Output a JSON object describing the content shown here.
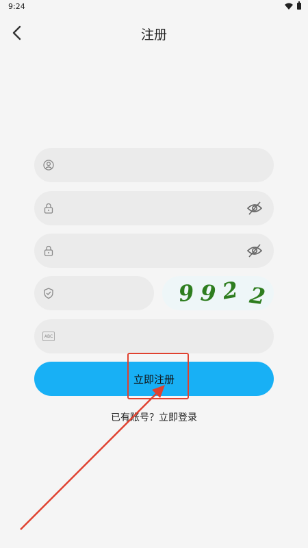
{
  "status_bar": {
    "time": "9:24"
  },
  "app_bar": {
    "title": "注册"
  },
  "form": {
    "username": {
      "value": "",
      "icon": "user-icon"
    },
    "password": {
      "value": "",
      "icon": "lock-icon"
    },
    "confirm_password": {
      "value": "",
      "icon": "lock-icon"
    },
    "captcha_input": {
      "value": "",
      "icon": "shield-check-icon"
    },
    "captcha_image": {
      "digits": [
        "9",
        "9",
        "2",
        "2"
      ],
      "color": "#2e7d1f"
    },
    "invite_code": {
      "value": "",
      "icon": "abc-icon",
      "icon_text": "ABC"
    }
  },
  "register_button": {
    "label": "立即注册",
    "color": "#18b0f5"
  },
  "login_link": {
    "label": "已有账号？立即登录"
  },
  "annotation": {
    "color": "#e0412f"
  }
}
